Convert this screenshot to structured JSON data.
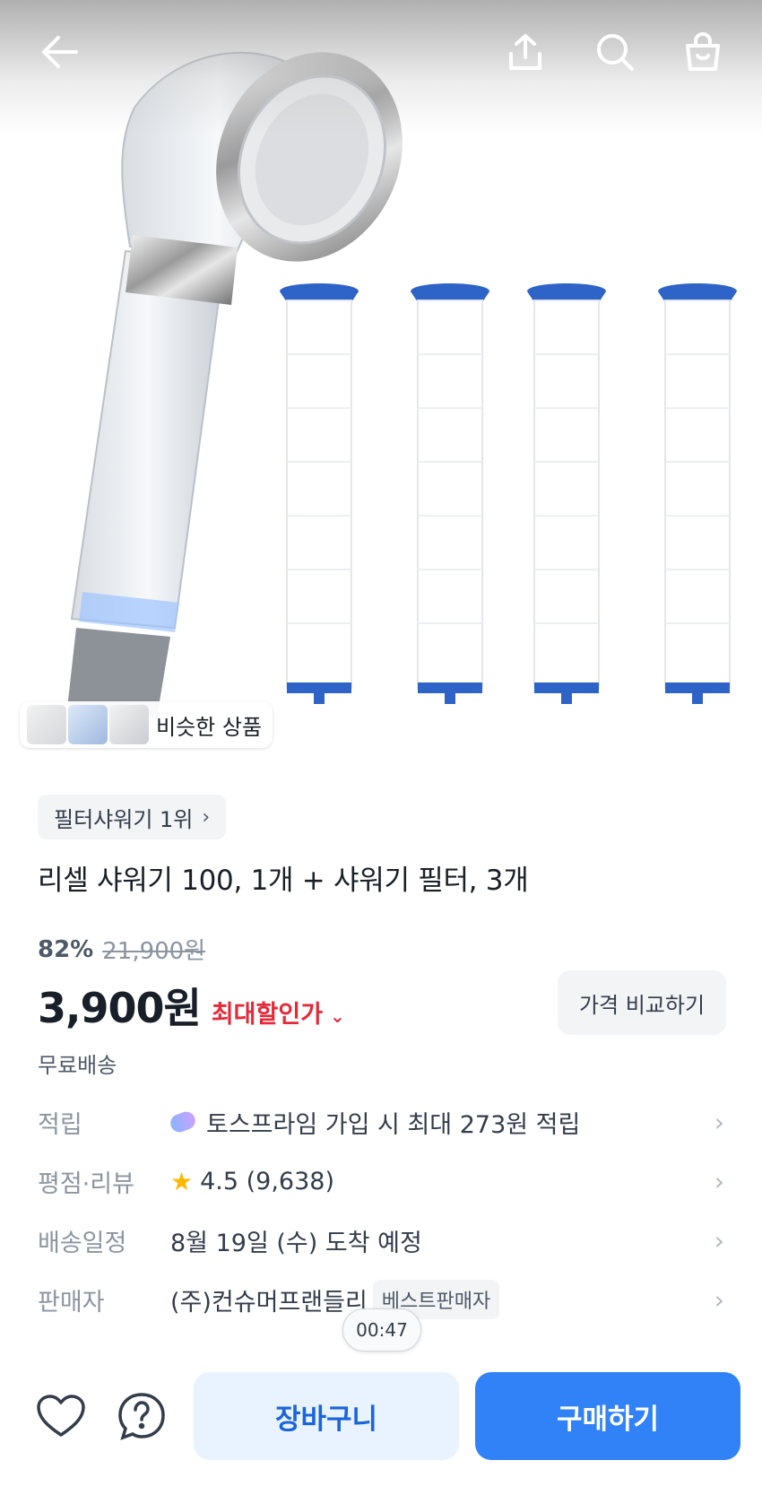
{
  "hero": {
    "similar_label": "비슷한 상품"
  },
  "topbar": {
    "icons": [
      "back-arrow-icon",
      "share-icon",
      "search-icon",
      "shopping-bag-icon"
    ]
  },
  "product": {
    "rank_badge": "필터샤워기 1위",
    "title": "리셀 샤워기 100, 1개 + 샤워기 필터, 3개",
    "discount_rate": "82%",
    "original_price": "21,900원",
    "price": "3,900원",
    "max_discount_label": "최대할인가",
    "compare_button": "가격 비교하기",
    "shipping": "무료배송"
  },
  "info": {
    "points": {
      "label": "적립",
      "value": "토스프라임 가입 시 최대 273원 적립"
    },
    "rating": {
      "label": "평점·리뷰",
      "value": "4.5 (9,638)",
      "rating": 4.5
    },
    "delivery": {
      "label": "배송일정",
      "value": "8월 19일 (수) 도착 예정"
    },
    "seller": {
      "label": "판매자",
      "value": "(주)컨슈머프랜들리",
      "badge": "베스트판매자"
    }
  },
  "timer": "00:47",
  "bottom": {
    "cart_label": "장바구니",
    "buy_label": "구매하기"
  },
  "colors": {
    "primary": "#3182f6",
    "cart_bg": "#e8f3ff",
    "discount_red": "#e42939",
    "filter_blue": "#2e63c8"
  }
}
